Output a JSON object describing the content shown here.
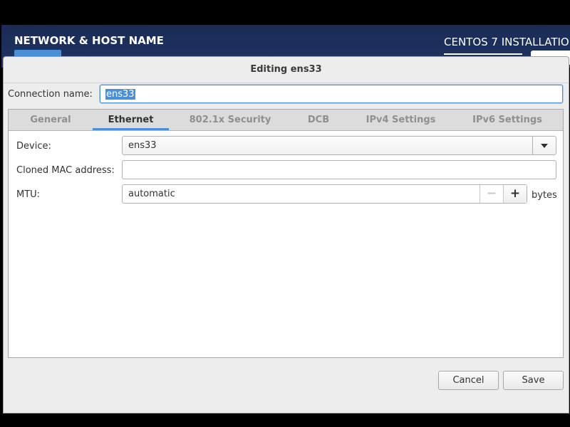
{
  "background": {
    "spoke_title": "NETWORK & HOST NAME",
    "installer_title": "CENTOS 7 INSTALLATIO"
  },
  "dialog": {
    "title": "Editing ens33",
    "connection_name_label": "Connection name:",
    "connection_name_value": "ens33",
    "tabs": [
      {
        "label": "General",
        "active": false
      },
      {
        "label": "Ethernet",
        "active": true
      },
      {
        "label": "802.1x Security",
        "active": false
      },
      {
        "label": "DCB",
        "active": false
      },
      {
        "label": "IPv4 Settings",
        "active": false
      },
      {
        "label": "IPv6 Settings",
        "active": false
      }
    ],
    "ethernet": {
      "device_label": "Device:",
      "device_value": "ens33",
      "cloned_mac_label": "Cloned MAC address:",
      "cloned_mac_value": "",
      "mtu_label": "MTU:",
      "mtu_value": "automatic",
      "mtu_minus": "−",
      "mtu_plus": "+",
      "mtu_unit": "bytes"
    },
    "buttons": {
      "cancel": "Cancel",
      "save": "Save"
    }
  },
  "colors": {
    "accent": "#4a90d9",
    "header_bg": "#1f3160"
  }
}
